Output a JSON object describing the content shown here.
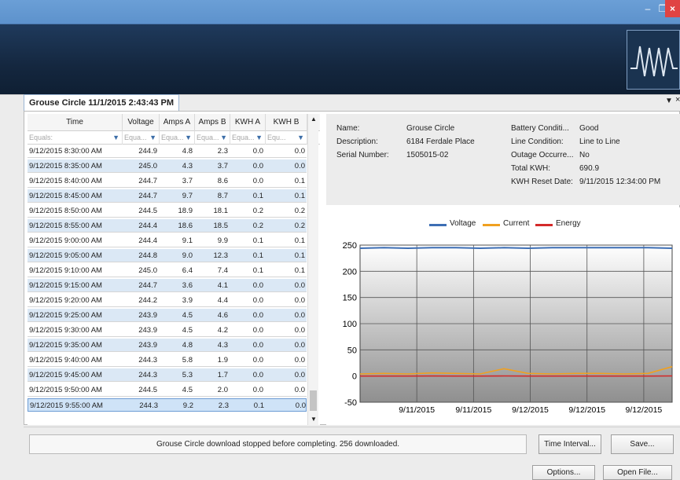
{
  "window": {
    "min": "–",
    "max": "❐",
    "close": "×"
  },
  "tab": {
    "title": "Grouse Circle 11/1/2015 2:43:43 PM"
  },
  "grid": {
    "columns": [
      "Time",
      "Voltage",
      "Amps A",
      "Amps B",
      "KWH A",
      "KWH B"
    ],
    "filters": [
      "Equals:",
      "Equa...",
      "Equa...",
      "Equa...",
      "Equa...",
      "Equ..."
    ],
    "rows": [
      [
        "9/12/2015 8:30:00 AM",
        "244.9",
        "4.8",
        "2.3",
        "0.0",
        "0.0"
      ],
      [
        "9/12/2015 8:35:00 AM",
        "245.0",
        "4.3",
        "3.7",
        "0.0",
        "0.0"
      ],
      [
        "9/12/2015 8:40:00 AM",
        "244.7",
        "3.7",
        "8.6",
        "0.0",
        "0.1"
      ],
      [
        "9/12/2015 8:45:00 AM",
        "244.7",
        "9.7",
        "8.7",
        "0.1",
        "0.1"
      ],
      [
        "9/12/2015 8:50:00 AM",
        "244.5",
        "18.9",
        "18.1",
        "0.2",
        "0.2"
      ],
      [
        "9/12/2015 8:55:00 AM",
        "244.4",
        "18.6",
        "18.5",
        "0.2",
        "0.2"
      ],
      [
        "9/12/2015 9:00:00 AM",
        "244.4",
        "9.1",
        "9.9",
        "0.1",
        "0.1"
      ],
      [
        "9/12/2015 9:05:00 AM",
        "244.8",
        "9.0",
        "12.3",
        "0.1",
        "0.1"
      ],
      [
        "9/12/2015 9:10:00 AM",
        "245.0",
        "6.4",
        "7.4",
        "0.1",
        "0.1"
      ],
      [
        "9/12/2015 9:15:00 AM",
        "244.7",
        "3.6",
        "4.1",
        "0.0",
        "0.0"
      ],
      [
        "9/12/2015 9:20:00 AM",
        "244.2",
        "3.9",
        "4.4",
        "0.0",
        "0.0"
      ],
      [
        "9/12/2015 9:25:00 AM",
        "243.9",
        "4.5",
        "4.6",
        "0.0",
        "0.0"
      ],
      [
        "9/12/2015 9:30:00 AM",
        "243.9",
        "4.5",
        "4.2",
        "0.0",
        "0.0"
      ],
      [
        "9/12/2015 9:35:00 AM",
        "243.9",
        "4.8",
        "4.3",
        "0.0",
        "0.0"
      ],
      [
        "9/12/2015 9:40:00 AM",
        "244.3",
        "5.8",
        "1.9",
        "0.0",
        "0.0"
      ],
      [
        "9/12/2015 9:45:00 AM",
        "244.3",
        "5.3",
        "1.7",
        "0.0",
        "0.0"
      ],
      [
        "9/12/2015 9:50:00 AM",
        "244.5",
        "4.5",
        "2.0",
        "0.0",
        "0.0"
      ],
      [
        "9/12/2015 9:55:00 AM",
        "244.3",
        "9.2",
        "2.3",
        "0.1",
        "0.0"
      ]
    ]
  },
  "details": {
    "name_label": "Name:",
    "name": "Grouse Circle",
    "description_label": "Description:",
    "description": "6184 Ferdale Place",
    "serial_label": "Serial Number:",
    "serial": "1505015-02",
    "battery_label": "Battery Conditi...",
    "battery": "Good",
    "line_label": "Line Condition:",
    "line": "Line to Line",
    "outage_label": "Outage Occurre...",
    "outage": "No",
    "total_label": "Total KWH:",
    "total": "690.9",
    "reset_label": "KWH Reset Date:",
    "reset": "9/11/2015 12:34:00 PM"
  },
  "chart_data": {
    "type": "line",
    "series": [
      {
        "name": "Voltage",
        "color": "#3d6eb4",
        "values": [
          244,
          245,
          244,
          245,
          245,
          244,
          245,
          244,
          245,
          245,
          245,
          245,
          245,
          244
        ]
      },
      {
        "name": "Current",
        "color": "#f0a020",
        "values": [
          4,
          5,
          4,
          6,
          5,
          4,
          14,
          5,
          4,
          5,
          5,
          4,
          5,
          18
        ]
      },
      {
        "name": "Energy",
        "color": "#d42a2a",
        "values": [
          0,
          0,
          0,
          0.1,
          0,
          0,
          0.2,
          0,
          0,
          0,
          0,
          0,
          0,
          0.2
        ]
      }
    ],
    "xticks": [
      "9/11/2015",
      "9/11/2015",
      "9/12/2015",
      "9/12/2015",
      "9/12/2015"
    ],
    "yticks": [
      "250",
      "200",
      "150",
      "100",
      "50",
      "0",
      "-50"
    ],
    "ylim": [
      -50,
      250
    ],
    "grid": true,
    "legend": "top"
  },
  "status": {
    "message": "Grouse Circle download stopped before completing. 256 downloaded."
  },
  "buttons": {
    "time_interval": "Time Interval...",
    "save": "Save...",
    "options": "Options...",
    "open_file": "Open File..."
  }
}
